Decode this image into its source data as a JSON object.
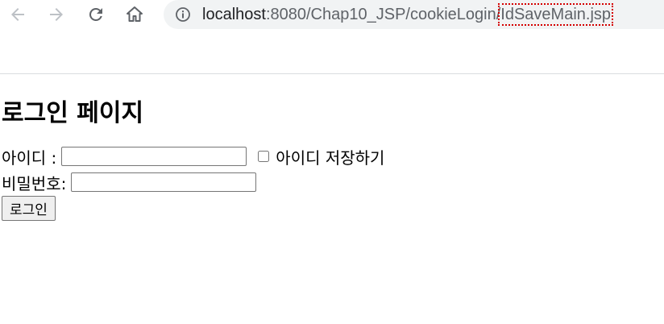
{
  "browser": {
    "url_host": "localhost",
    "url_path_prefix": ":8080/Chap10_JSP/cookieLogin/",
    "url_highlighted": "IdSaveMain.jsp"
  },
  "page": {
    "heading": "로그인 페이지",
    "id_label": "아이디 :",
    "id_value": "",
    "save_id_label": "아이디 저장하기",
    "password_label": "비밀번호:",
    "password_value": "",
    "login_button": "로그인"
  },
  "colors": {
    "omnibox_bg": "#f1f3f4",
    "highlight_outline": "#d40000"
  }
}
